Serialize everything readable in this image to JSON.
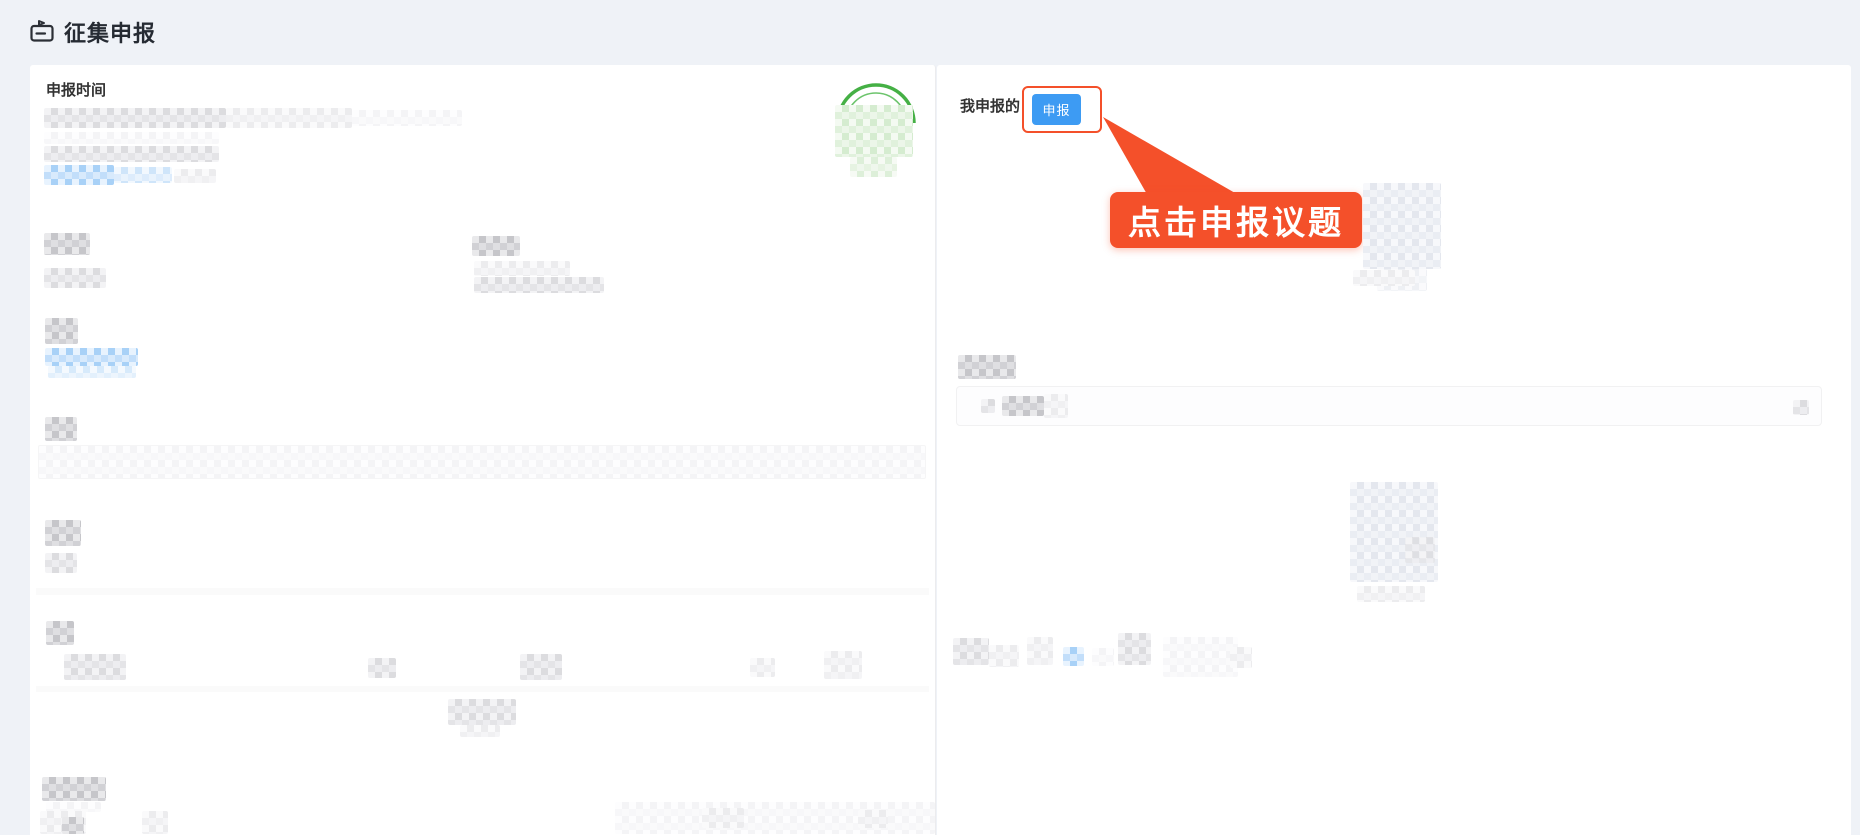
{
  "header": {
    "title": "征集申报",
    "icon": "clipboard-badge-icon"
  },
  "left_panel": {
    "section_title": "申报时间",
    "stamp_icon": "green-circular-seal"
  },
  "right_panel": {
    "my_list_label": "我申报的",
    "declare_button_label": "申报",
    "callout_text": "点击申报议题"
  },
  "colors": {
    "page_bg": "#eff2f7",
    "primary_blue": "#3d9bf3",
    "callout_orange": "#f4502a",
    "stamp_green": "#45b045"
  }
}
